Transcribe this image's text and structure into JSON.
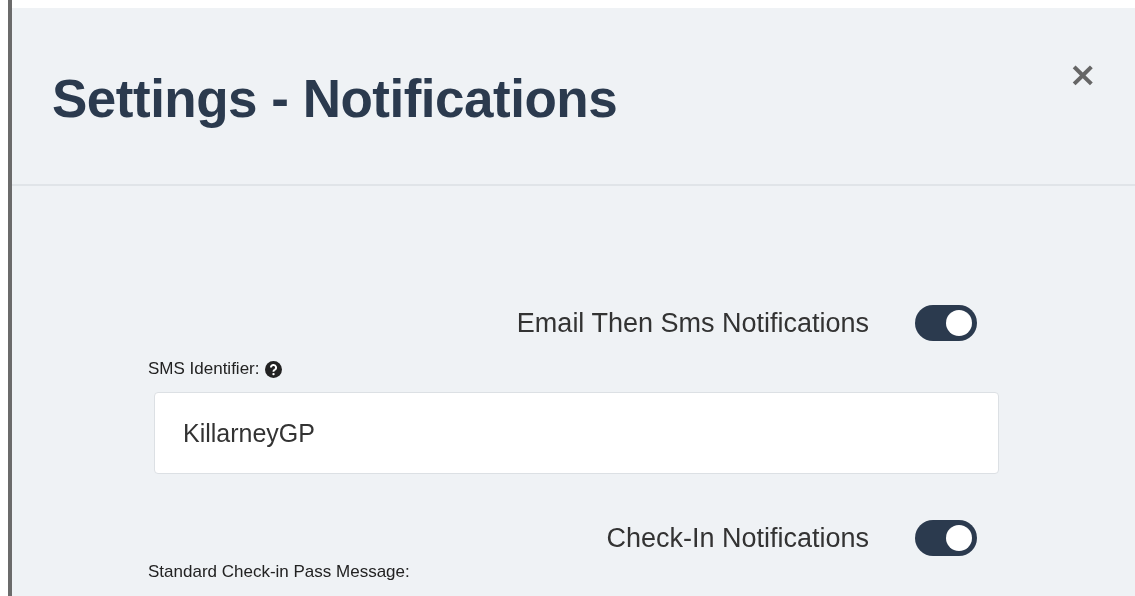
{
  "dialog": {
    "title": "Settings - Notifications",
    "close": "×"
  },
  "settings": [
    {
      "kind": "toggle",
      "label": "Email Then Sms Notifications",
      "on": true
    },
    {
      "kind": "text",
      "label": "SMS Identifier:",
      "help": true,
      "value": "KillarneyGP"
    },
    {
      "kind": "toggle",
      "label": "Check-In Notifications",
      "on": true
    },
    {
      "kind": "caption",
      "label": "Standard Check-in Pass Message:"
    }
  ]
}
